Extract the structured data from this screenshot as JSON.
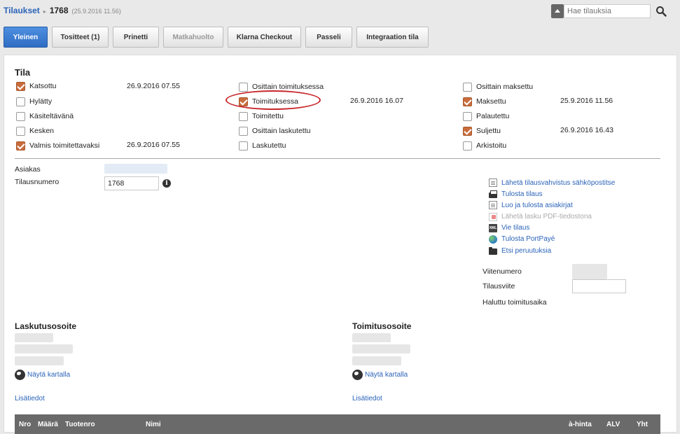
{
  "header": {
    "breadcrumb_link": "Tilaukset",
    "order_number": "1768",
    "order_datetime": "(25.9.2016 11.56)"
  },
  "search": {
    "placeholder": "Hae tilauksia"
  },
  "tabs": [
    {
      "label": "Yleinen",
      "active": true
    },
    {
      "label": "Tositteet (1)"
    },
    {
      "label": "Prinetti"
    },
    {
      "label": "Matkahuolto",
      "disabled": true
    },
    {
      "label": "Klarna Checkout"
    },
    {
      "label": "Passeli"
    },
    {
      "label": "Integraation tila"
    }
  ],
  "status": {
    "title": "Tila",
    "col1": [
      {
        "label": "Katsottu",
        "checked": true,
        "date": "26.9.2016 07.55"
      },
      {
        "label": "Hylätty",
        "checked": false,
        "date": ""
      },
      {
        "label": "Käsiteltävänä",
        "checked": false,
        "date": ""
      },
      {
        "label": "Kesken",
        "checked": false,
        "date": ""
      },
      {
        "label": "Valmis toimitettavaksi",
        "checked": true,
        "date": "26.9.2016 07.55"
      }
    ],
    "col2": [
      {
        "label": "Osittain toimituksessa",
        "checked": false,
        "date": ""
      },
      {
        "label": "Toimituksessa",
        "checked": true,
        "date": "26.9.2016 16.07"
      },
      {
        "label": "Toimitettu",
        "checked": false,
        "date": ""
      },
      {
        "label": "Osittain laskutettu",
        "checked": false,
        "date": ""
      },
      {
        "label": "Laskutettu",
        "checked": false,
        "date": ""
      }
    ],
    "col3": [
      {
        "label": "Osittain maksettu",
        "checked": false,
        "date": ""
      },
      {
        "label": "Maksettu",
        "checked": true,
        "date": "25.9.2016 11.56"
      },
      {
        "label": "Palautettu",
        "checked": false,
        "date": ""
      },
      {
        "label": "Suljettu",
        "checked": true,
        "date": "26.9.2016 16.43"
      },
      {
        "label": "Arkistoitu",
        "checked": false,
        "date": ""
      }
    ]
  },
  "details": {
    "customer_label": "Asiakas",
    "order_number_label": "Tilausnumero",
    "order_number_value": "1768",
    "reference_label": "Viitenumero",
    "order_reference_label": "Tilausviite",
    "order_reference_value": "",
    "delivery_time_label": "Haluttu toimitusaika"
  },
  "actions": [
    {
      "label": "Lähetä tilausvahvistus sähköpostitse",
      "icon": "email-document-icon",
      "enabled": true
    },
    {
      "label": "Tulosta tilaus",
      "icon": "printer-icon",
      "enabled": true
    },
    {
      "label": "Luo ja tulosta asiakirjat",
      "icon": "document-icon",
      "enabled": true
    },
    {
      "label": "Lähetä lasku PDF-tiedostona",
      "icon": "pdf-icon",
      "enabled": false
    },
    {
      "label": "Vie tilaus",
      "icon": "xml-export-icon",
      "enabled": true
    },
    {
      "label": "Tulosta PortPayé",
      "icon": "globe-icon",
      "enabled": true
    },
    {
      "label": "Etsi peruutuksia",
      "icon": "folder-icon",
      "enabled": true
    }
  ],
  "billing": {
    "title": "Laskutusosoite",
    "map_link": "Näytä kartalla",
    "more_link": "Lisätiedot"
  },
  "shipping": {
    "title": "Toimitusosoite",
    "map_link": "Näytä kartalla",
    "more_link": "Lisätiedot"
  },
  "table": {
    "columns": [
      "Nro",
      "Määrä",
      "Tuotenro",
      "Nimi",
      "à-hinta",
      "ALV",
      "Yht"
    ]
  }
}
